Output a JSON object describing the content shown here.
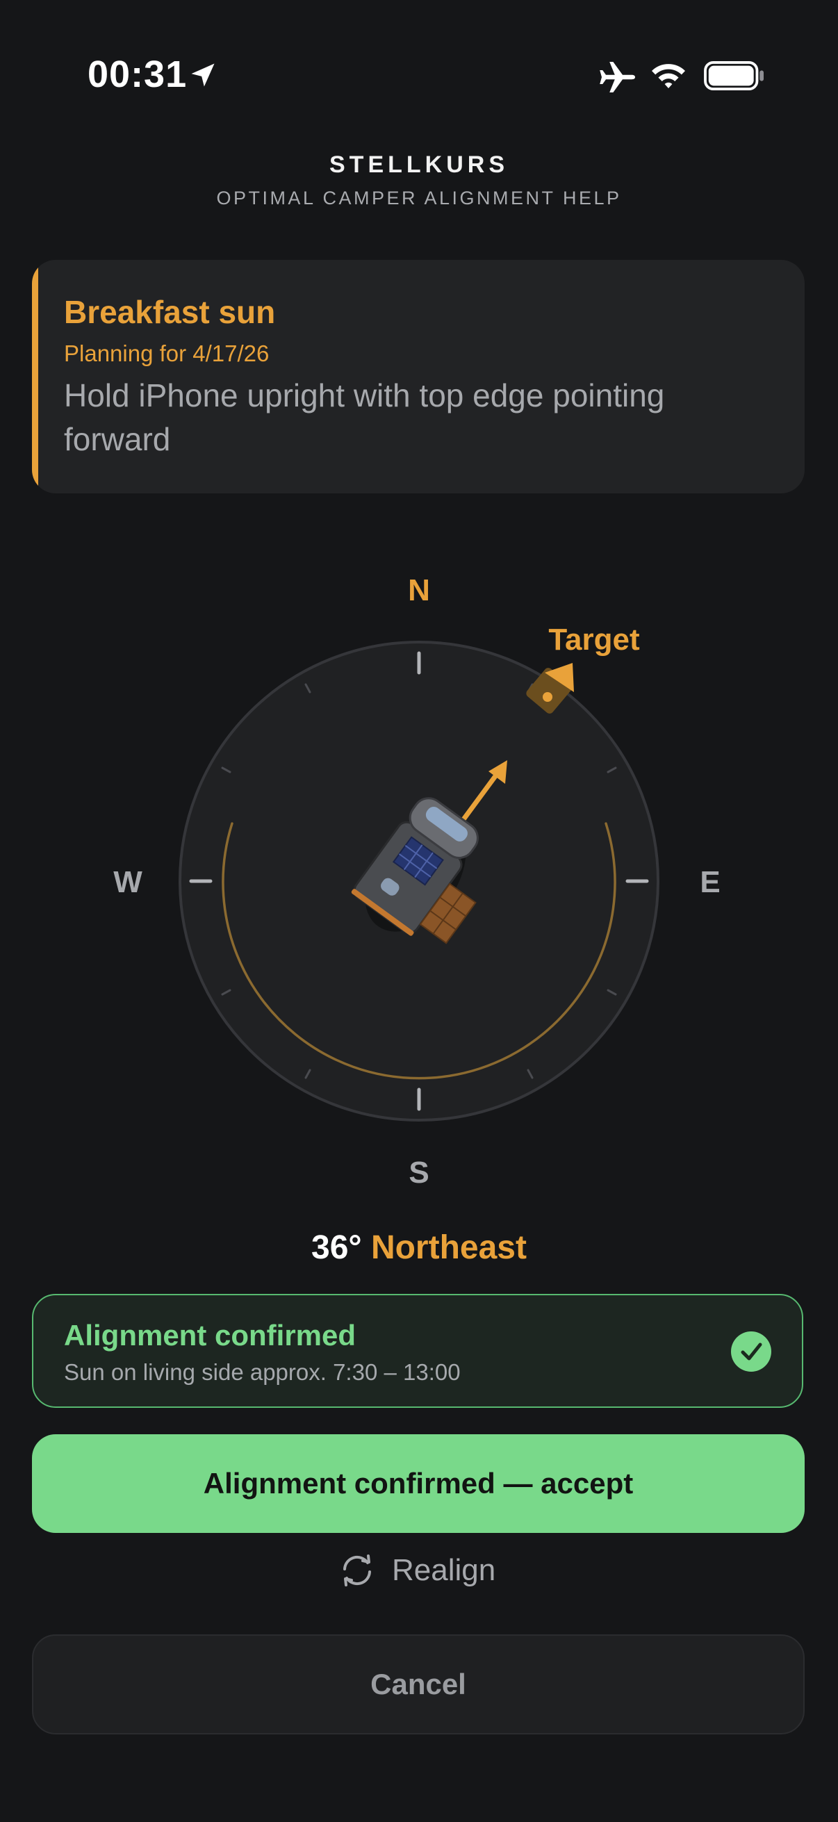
{
  "status_bar": {
    "time": "00:31",
    "icons": [
      "location-arrow-icon",
      "airplane-mode-icon",
      "wifi-icon",
      "battery-icon"
    ]
  },
  "header": {
    "title": "STELLKURS",
    "subtitle": "OPTIMAL CAMPER ALIGNMENT HELP"
  },
  "info_card": {
    "title": "Breakfast sun",
    "date": "Planning for 4/17/26",
    "instruction": "Hold iPhone upright with top edge pointing forward"
  },
  "compass": {
    "north": "N",
    "east": "E",
    "south": "S",
    "west": "W",
    "target_label": "Target",
    "heading_degrees": 36,
    "target_degrees": 40,
    "icons": [
      "camper-van-icon",
      "target-marker-icon",
      "heading-arrow-icon"
    ]
  },
  "heading": {
    "degrees_text": "36°",
    "direction": "Northeast"
  },
  "confirmation": {
    "title": "Alignment confirmed",
    "subtitle": "Sun on living side approx. 7:30 – 13:00",
    "icon": "checkmark-icon"
  },
  "actions": {
    "accept_label": "Alignment confirmed — accept",
    "realign_label": "Realign",
    "realign_icon": "refresh-icon",
    "cancel_label": "Cancel"
  },
  "colors": {
    "accent": "#e9a23a",
    "success": "#79d98a",
    "background": "#151618",
    "card": "#222325"
  }
}
